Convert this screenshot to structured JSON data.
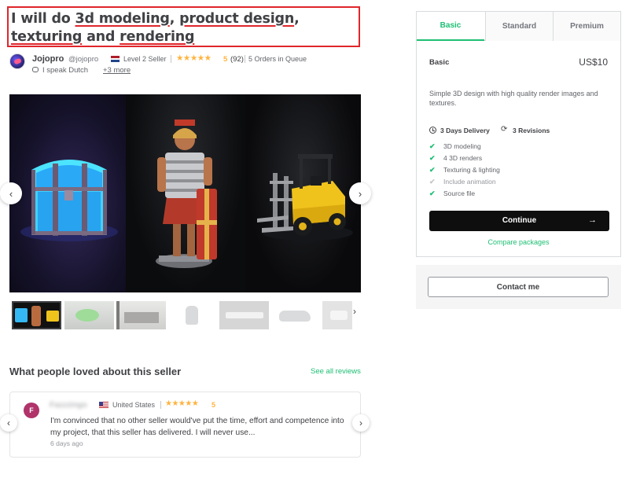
{
  "title": {
    "prefix": "I will do ",
    "part1": "3d modeling",
    "comma1": ", ",
    "part2": "product design",
    "comma2": ", ",
    "part3": "texturing",
    "and": " and ",
    "part4": "rendering"
  },
  "seller": {
    "name": "Jojopro",
    "handle": "@jojopro",
    "level": "Level 2 Seller",
    "stars": "★★★★★",
    "rating": "5",
    "rating_count": "(92)",
    "orders": "5 Orders in Queue",
    "speaks": "I speak Dutch",
    "more_languages": "+3 more"
  },
  "gallery": {
    "prev_glyph": "‹",
    "next_glyph": "›",
    "thumb_next_glyph": "›"
  },
  "reviews": {
    "section_title": "What people loved about this seller",
    "see_all": "See all reviews",
    "prev_glyph": "‹",
    "next_glyph": "›",
    "item": {
      "avatar_initial": "F",
      "reviewer_name": "Fazzzingo",
      "country": "United States",
      "stars": "★★★★★",
      "score": "5",
      "text": "I'm convinced that no other seller would've put the time, effort and competence into my project, that this seller has delivered. I will never use...",
      "date": "6 days ago"
    }
  },
  "packages": {
    "tabs": [
      "Basic",
      "Standard",
      "Premium"
    ],
    "active_tab": "Basic",
    "name": "Basic",
    "price": "US$10",
    "description": "Simple 3D design with high quality render images and textures.",
    "delivery": "3 Days Delivery",
    "revisions": "3 Revisions",
    "features": [
      {
        "label": "3D modeling",
        "included": true
      },
      {
        "label": "4 3D renders",
        "included": true
      },
      {
        "label": "Texturing & lighting",
        "included": true
      },
      {
        "label": "Include animation",
        "included": false
      },
      {
        "label": "Source file",
        "included": true
      }
    ],
    "check_glyph": "✔",
    "continue_label": "Continue",
    "continue_arrow": "→",
    "compare_label": "Compare packages"
  },
  "contact": {
    "label": "Contact me"
  },
  "colors": {
    "brand_green": "#1dbf73",
    "star_yellow": "#ffb33e",
    "highlight_red": "#e0262b",
    "text_dark": "#404145"
  }
}
